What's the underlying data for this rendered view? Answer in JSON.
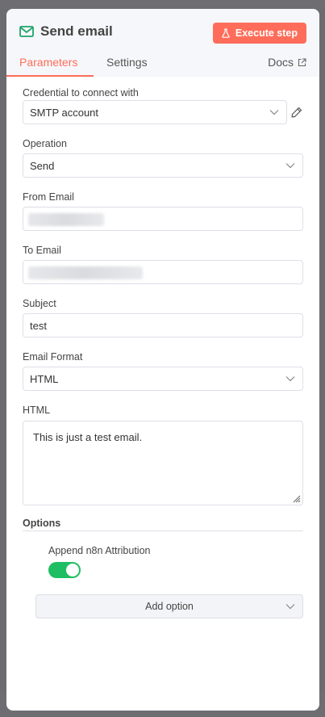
{
  "node": {
    "title": "Send email",
    "icon": "mail-icon",
    "execute_label": "Execute step",
    "accent": "#ff6d5a"
  },
  "tabs": [
    {
      "label": "Parameters",
      "active": true
    },
    {
      "label": "Settings",
      "active": false
    }
  ],
  "docs_label": "Docs",
  "fields": {
    "credential": {
      "label": "Credential to connect with",
      "value": "SMTP account"
    },
    "operation": {
      "label": "Operation",
      "value": "Send"
    },
    "from_email": {
      "label": "From Email",
      "value": ""
    },
    "to_email": {
      "label": "To Email",
      "value": ""
    },
    "subject": {
      "label": "Subject",
      "value": "test"
    },
    "email_format": {
      "label": "Email Format",
      "value": "HTML"
    },
    "html": {
      "label": "HTML",
      "value": "This is just a test email."
    }
  },
  "options": {
    "label": "Options",
    "append_attribution": {
      "label": "Append n8n Attribution",
      "enabled": true,
      "color": "#1fbe62"
    },
    "add_option_label": "Add option"
  }
}
